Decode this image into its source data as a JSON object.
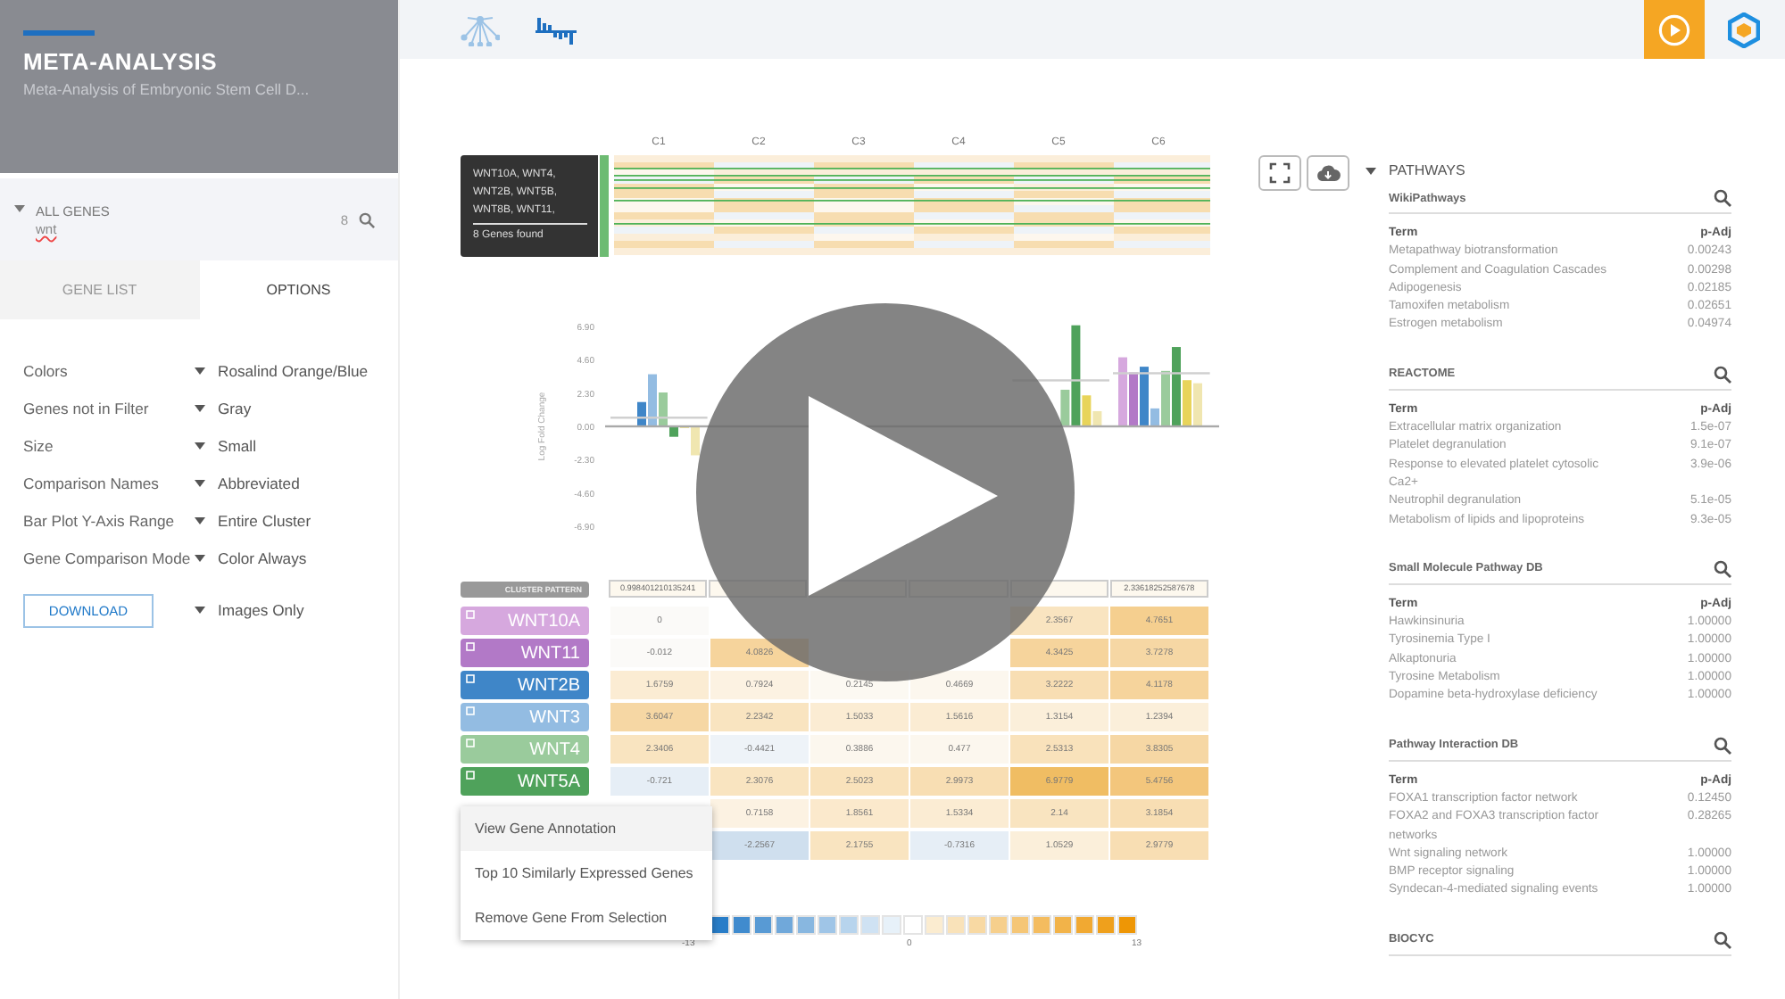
{
  "sidebar": {
    "title": "META-ANALYSIS",
    "subtitle": "Meta-Analysis of Embryonic Stem Cell D...",
    "filter": {
      "label": "ALL GENES",
      "value": "wnt",
      "count": "8"
    },
    "tabs": [
      {
        "label": "GENE LIST",
        "selected": false
      },
      {
        "label": "OPTIONS",
        "selected": true
      }
    ],
    "options": [
      {
        "label": "Colors",
        "value": "Rosalind Orange/Blue"
      },
      {
        "label": "Genes not in Filter",
        "value": "Gray"
      },
      {
        "label": "Size",
        "value": "Small"
      },
      {
        "label": "Comparison Names",
        "value": "Abbreviated"
      },
      {
        "label": "Bar Plot Y-Axis Range",
        "value": "Entire Cluster"
      },
      {
        "label": "Gene Comparison Mode",
        "value": "Color Always"
      }
    ],
    "download": {
      "label": "DOWNLOAD",
      "value": "Images Only"
    }
  },
  "toolbar": {
    "views": [
      {
        "kind": "network",
        "selected": false
      },
      {
        "kind": "bars",
        "selected": true
      }
    ]
  },
  "heatmap": {
    "columns": [
      "C1",
      "C2",
      "C3",
      "C4",
      "C5",
      "C6"
    ],
    "tooltip": {
      "genes": "WNT10A, WNT4, WNT2B, WNT5B, WNT8B, WNT11,",
      "count": "8 Genes found"
    }
  },
  "chart": {
    "ylabel": "Log Fold Change",
    "yticks": [
      "6.90",
      "4.60",
      "2.30",
      "0.00",
      "-2.30",
      "-4.60",
      "-6.90"
    ]
  },
  "table": {
    "header_label": "CLUSTER PATTERN",
    "cluster_pattern": {
      "first": "0.998401210135241",
      "last": "2.33618252587678"
    },
    "rows": [
      {
        "gene": "WNT10A",
        "color": "#d6a8de",
        "cells": [
          {
            "text": "0",
            "color": "#fbfaf8"
          },
          null,
          null,
          null,
          {
            "text": "2.3567",
            "color": "#f9e4c0"
          },
          {
            "text": "4.7651",
            "color": "#f5cf8f"
          }
        ]
      },
      {
        "gene": "WNT11",
        "color": "#b279c7",
        "cells": [
          {
            "text": "-0.012",
            "color": "#fbfaf8"
          },
          {
            "text": "4.0826",
            "color": "#f6d49c"
          },
          null,
          null,
          {
            "text": "4.3425",
            "color": "#f6d49c"
          },
          {
            "text": "3.7278",
            "color": "#f6d7a4"
          }
        ]
      },
      {
        "gene": "WNT2B",
        "color": "#3f86c8",
        "cells": [
          {
            "text": "1.6759",
            "color": "#fbecd3"
          },
          {
            "text": "0.7924",
            "color": "#fcf2e2"
          },
          {
            "text": "0.2145",
            "color": "#fcf9f2"
          },
          {
            "text": "0.4669",
            "color": "#fcf7ee"
          },
          {
            "text": "3.2222",
            "color": "#f8deb3"
          },
          {
            "text": "4.1178",
            "color": "#f6d49c"
          }
        ]
      },
      {
        "gene": "WNT3",
        "color": "#93bce2",
        "cells": [
          {
            "text": "3.6047",
            "color": "#f6d7a4"
          },
          {
            "text": "2.2342",
            "color": "#f9e4c0"
          },
          {
            "text": "1.5033",
            "color": "#fbecd3"
          },
          {
            "text": "1.5616",
            "color": "#fbecd3"
          },
          {
            "text": "1.3154",
            "color": "#fbefda"
          },
          {
            "text": "1.2394",
            "color": "#fbefda"
          }
        ]
      },
      {
        "gene": "WNT4",
        "color": "#9acb9c",
        "cells": [
          {
            "text": "2.3406",
            "color": "#f9e4c0"
          },
          {
            "text": "-0.4421",
            "color": "#eef3f8"
          },
          {
            "text": "0.3886",
            "color": "#fcf7ee"
          },
          {
            "text": "0.477",
            "color": "#fcf7ee"
          },
          {
            "text": "2.5313",
            "color": "#f9e2bb"
          },
          {
            "text": "3.8305",
            "color": "#f6d7a4"
          }
        ]
      },
      {
        "gene": "WNT5A",
        "color": "#4fa25b",
        "cells": [
          {
            "text": "-0.721",
            "color": "#e6eef6"
          },
          {
            "text": "2.3076",
            "color": "#f9e4c0"
          },
          {
            "text": "2.5023",
            "color": "#f9e2bb"
          },
          {
            "text": "2.9973",
            "color": "#f8deb3"
          },
          {
            "text": "6.9779",
            "color": "#f0bd63"
          },
          {
            "text": "5.4756",
            "color": "#f3c67c"
          }
        ]
      },
      {
        "cells": [
          {
            "text": "0.7158",
            "color": "#fcf2e2"
          },
          {
            "text": "1.8561",
            "color": "#fbe9cc"
          },
          {
            "text": "1.5334",
            "color": "#fbecd3"
          },
          {
            "text": "2.14",
            "color": "#f9e4c0"
          },
          {
            "text": "3.1854",
            "color": "#f8deb3"
          }
        ]
      },
      {
        "cells": [
          {
            "text": "-2.2567",
            "color": "#cfdfee"
          },
          {
            "text": "2.1755",
            "color": "#f9e4c0"
          },
          {
            "text": "-0.7316",
            "color": "#e6eef6"
          },
          {
            "text": "1.0529",
            "color": "#fbefda"
          },
          {
            "text": "2.9779",
            "color": "#f8deb3"
          }
        ]
      }
    ]
  },
  "scale": {
    "labels": [
      "-13",
      "0",
      "13"
    ]
  },
  "context_menu": {
    "items": [
      {
        "label": "View Gene Annotation",
        "selected": true
      },
      {
        "label": "Top 10 Similarly Expressed Genes",
        "selected": false
      },
      {
        "label": "Remove Gene From Selection",
        "selected": false
      }
    ]
  },
  "pathways": {
    "title": "PATHWAYS",
    "sections": [
      {
        "title": "WikiPathways",
        "columns": [
          "Term",
          "p-Adj"
        ],
        "rows": [
          {
            "term": "Metapathway biotransformation",
            "p_adj": "0.00243"
          },
          {
            "term": "Complement and Coagulation Cascades",
            "p_adj": "0.00298"
          },
          {
            "term": "Adipogenesis",
            "p_adj": "0.02185"
          },
          {
            "term": "Tamoxifen metabolism",
            "p_adj": "0.02651"
          },
          {
            "term": "Estrogen metabolism",
            "p_adj": "0.04974"
          }
        ]
      },
      {
        "title": "REACTOME",
        "columns": [
          "Term",
          "p-Adj"
        ],
        "rows": [
          {
            "term": "Extracellular matrix organization",
            "p_adj": "1.5e-07"
          },
          {
            "term": "Platelet degranulation",
            "p_adj": "9.1e-07"
          },
          {
            "term": "Response to elevated platelet cytosolic Ca2+",
            "p_adj": "3.9e-06"
          },
          {
            "term": "Neutrophil degranulation",
            "p_adj": "5.1e-05"
          },
          {
            "term": "Metabolism of lipids and lipoproteins",
            "p_adj": "9.3e-05"
          }
        ]
      },
      {
        "title": "Small Molecule Pathway DB",
        "columns": [
          "Term",
          "p-Adj"
        ],
        "rows": [
          {
            "term": "Hawkinsinuria",
            "p_adj": "1.00000"
          },
          {
            "term": "Tyrosinemia Type I",
            "p_adj": "1.00000"
          },
          {
            "term": "Alkaptonuria",
            "p_adj": "1.00000"
          },
          {
            "term": "Tyrosine Metabolism",
            "p_adj": "1.00000"
          },
          {
            "term": "Dopamine beta-hydroxylase deficiency",
            "p_adj": "1.00000"
          }
        ]
      },
      {
        "title": "Pathway Interaction DB",
        "columns": [
          "Term",
          "p-Adj"
        ],
        "rows": [
          {
            "term": "FOXA1 transcription factor network",
            "p_adj": "0.12450"
          },
          {
            "term": "FOXA2 and FOXA3 transcription factor networks",
            "p_adj": "0.28265"
          },
          {
            "term": "Wnt signaling network",
            "p_adj": "1.00000"
          },
          {
            "term": "BMP receptor signaling",
            "p_adj": "1.00000"
          },
          {
            "term": "Syndecan-4-mediated signaling events",
            "p_adj": "1.00000"
          }
        ]
      },
      {
        "title": "BIOCYC"
      }
    ]
  }
}
